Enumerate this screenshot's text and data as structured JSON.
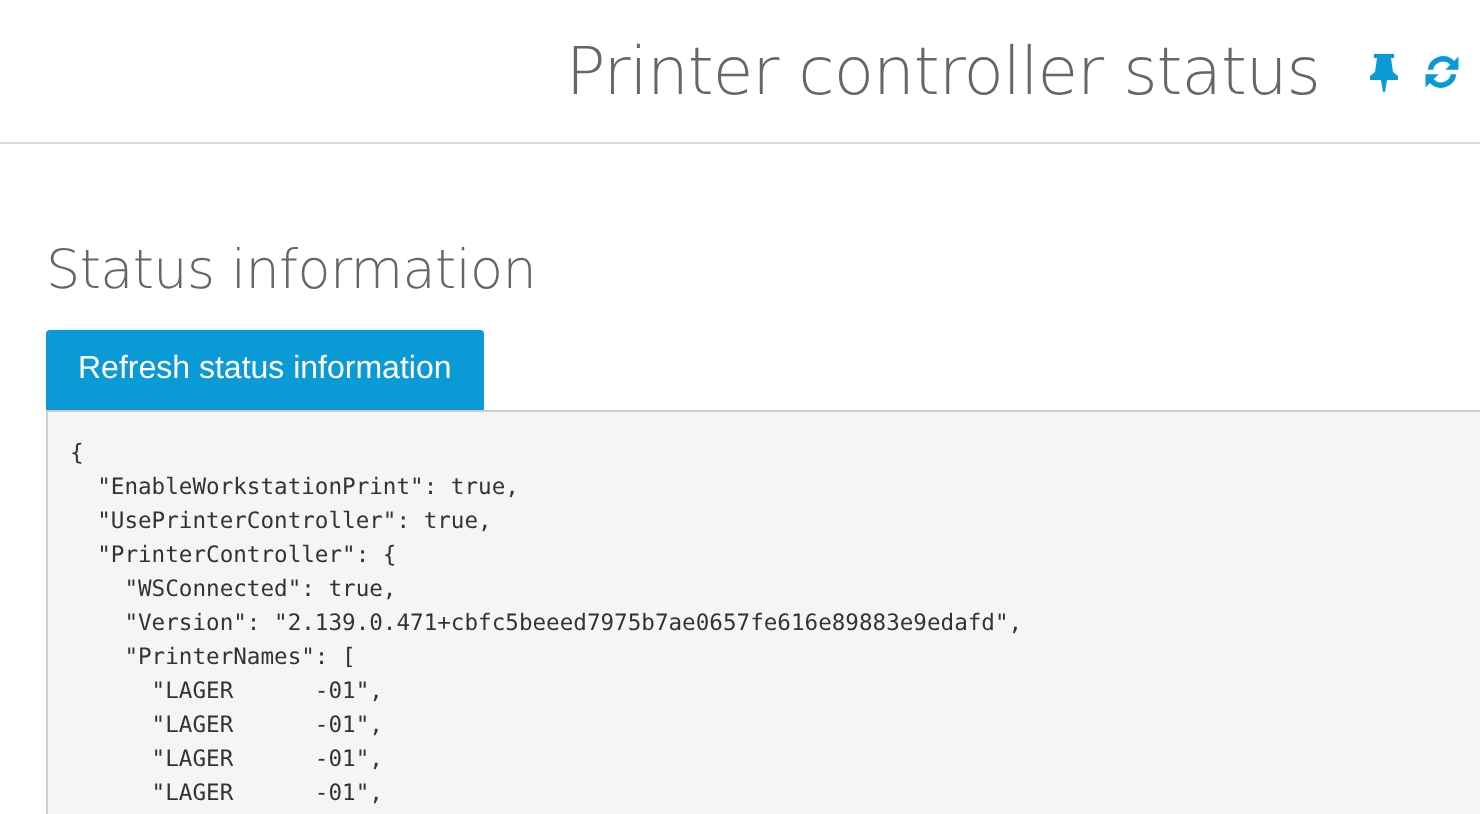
{
  "header": {
    "title": "Printer controller status"
  },
  "section": {
    "title": "Status information",
    "button": "Refresh status information",
    "code_lines": [
      "{",
      "  \"EnableWorkstationPrint\": true,",
      "  \"UsePrinterController\": true,",
      "  \"PrinterController\": {",
      "    \"WSConnected\": true,",
      "    \"Version\": \"2.139.0.471+cbfc5beeed7975b7ae0657fe616e89883e9edafd\",",
      "    \"PrinterNames\": [",
      "      \"LAGER      -01\",",
      "      \"LAGER      -01\",",
      "      \"LAGER      -01\",",
      "      \"LAGER      -01\","
    ]
  }
}
